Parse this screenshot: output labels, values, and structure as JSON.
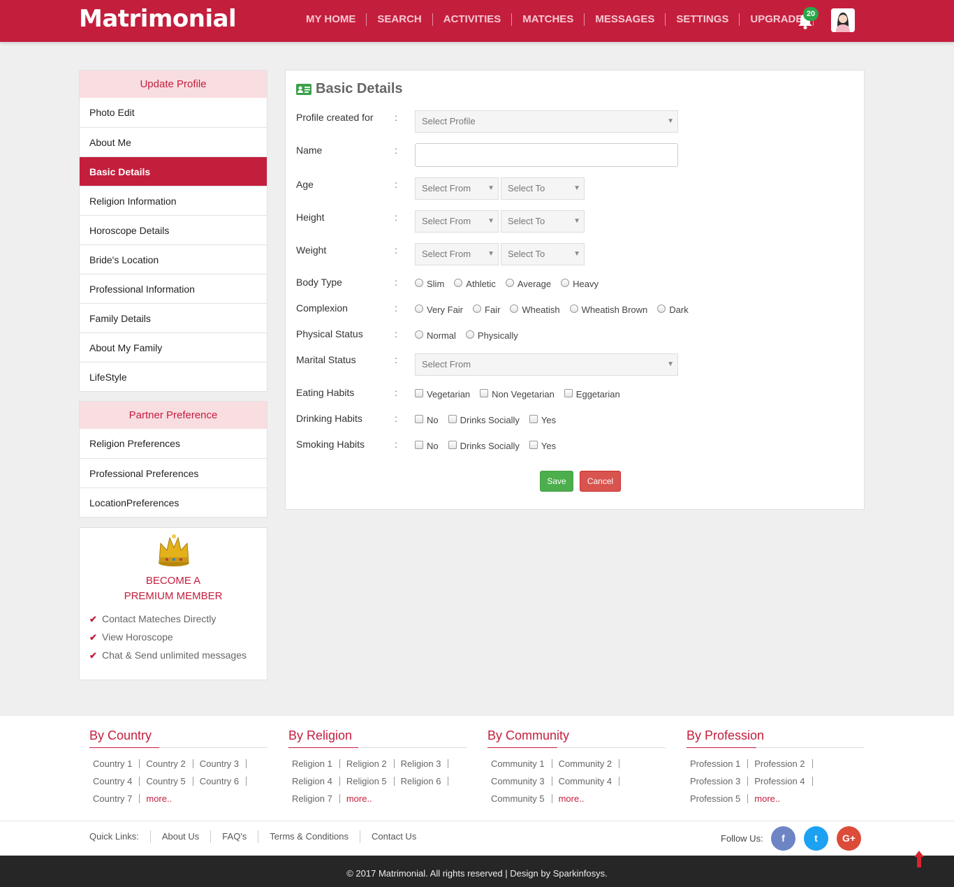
{
  "header": {
    "logo": "Matrimonial",
    "nav": [
      "MY HOME",
      "SEARCH",
      "ACTIVITIES",
      "MATCHES",
      "MESSAGES",
      "SETTINGS",
      "UPGRADE"
    ],
    "notification_count": "20",
    "brand_color": "#c41e3d"
  },
  "sidebar": {
    "update_profile_title": "Update Profile",
    "update_items": [
      "Photo Edit",
      "About Me",
      "Basic Details",
      "Religion Information",
      "Horoscope Details",
      "Bride's Location",
      "Professional Information",
      "Family Details",
      "About My Family",
      "LifeStyle"
    ],
    "active_item": "Basic Details",
    "partner_title": "Partner Preference",
    "partner_items": [
      "Religion Preferences",
      "Professional Preferences",
      "LocationPreferences"
    ]
  },
  "premium": {
    "title_line1": "BECOME A",
    "title_line2": "PREMIUM MEMBER",
    "features": [
      "Contact Mateches Directly",
      "View Horoscope",
      "Chat & Send unlimited messages"
    ]
  },
  "form": {
    "title": "Basic Details",
    "colon": ":",
    "profile_created_label": "Profile created for",
    "profile_created_placeholder": "Select Profile",
    "name_label": "Name",
    "name_value": "",
    "age_label": "Age",
    "height_label": "Height",
    "weight_label": "Weight",
    "select_from": "Select From",
    "select_to": "Select To",
    "body_type_label": "Body Type",
    "body_type_options": [
      "Slim",
      "Athletic",
      "Average",
      "Heavy"
    ],
    "complexion_label": "Complexion",
    "complexion_options": [
      "Very Fair",
      "Fair",
      "Wheatish",
      "Wheatish Brown",
      "Dark"
    ],
    "physical_status_label": "Physical Status",
    "physical_status_options": [
      "Normal",
      "Physically"
    ],
    "marital_status_label": "Marital Status",
    "marital_status_placeholder": "Select From",
    "eating_label": "Eating Habits",
    "eating_options": [
      "Vegetarian",
      "Non Vegetarian",
      "Eggetarian"
    ],
    "drinking_label": "Drinking Habits",
    "drinking_options": [
      "No",
      "Drinks Socially",
      "Yes"
    ],
    "smoking_label": "Smoking Habits",
    "smoking_options": [
      "No",
      "Drinks Socially",
      "Yes"
    ],
    "save_label": "Save",
    "cancel_label": "Cancel"
  },
  "footer": {
    "columns": [
      {
        "title": "By Country",
        "rows": [
          [
            "Country 1",
            "Country 2",
            "Country 3"
          ],
          [
            "Country 4",
            "Country 5",
            "Country 6"
          ],
          [
            "Country 7"
          ]
        ]
      },
      {
        "title": "By Religion",
        "rows": [
          [
            "Religion 1",
            "Religion 2",
            "Religion 3"
          ],
          [
            "Religion 4",
            "Religion 5",
            "Religion 6"
          ],
          [
            "Religion 7"
          ]
        ]
      },
      {
        "title": "By Community",
        "rows": [
          [
            "Community 1",
            "Community 2"
          ],
          [
            "Community 3",
            "Community 4"
          ],
          [
            "Community 5"
          ]
        ]
      },
      {
        "title": "By Profession",
        "rows": [
          [
            "Profession 1",
            "Profession 2"
          ],
          [
            "Profession 3",
            "Profession 4"
          ],
          [
            "Profession 5"
          ]
        ]
      }
    ],
    "more_label": "more..",
    "quick_links_label": "Quick Links:",
    "quick_links": [
      "About Us",
      "FAQ's",
      "Terms & Conditions",
      "Contact Us"
    ],
    "follow_label": "Follow Us:",
    "social": [
      {
        "icon": "facebook-icon",
        "glyph": "f",
        "color": "#6d84c5"
      },
      {
        "icon": "twitter-icon",
        "glyph": "t",
        "color": "#1da1f2"
      },
      {
        "icon": "google-plus-icon",
        "glyph": "G+",
        "color": "#dd4b39"
      }
    ],
    "copyright": "© 2017 Matrimonial. All rights reserved | Design by Sparkinfosys."
  }
}
